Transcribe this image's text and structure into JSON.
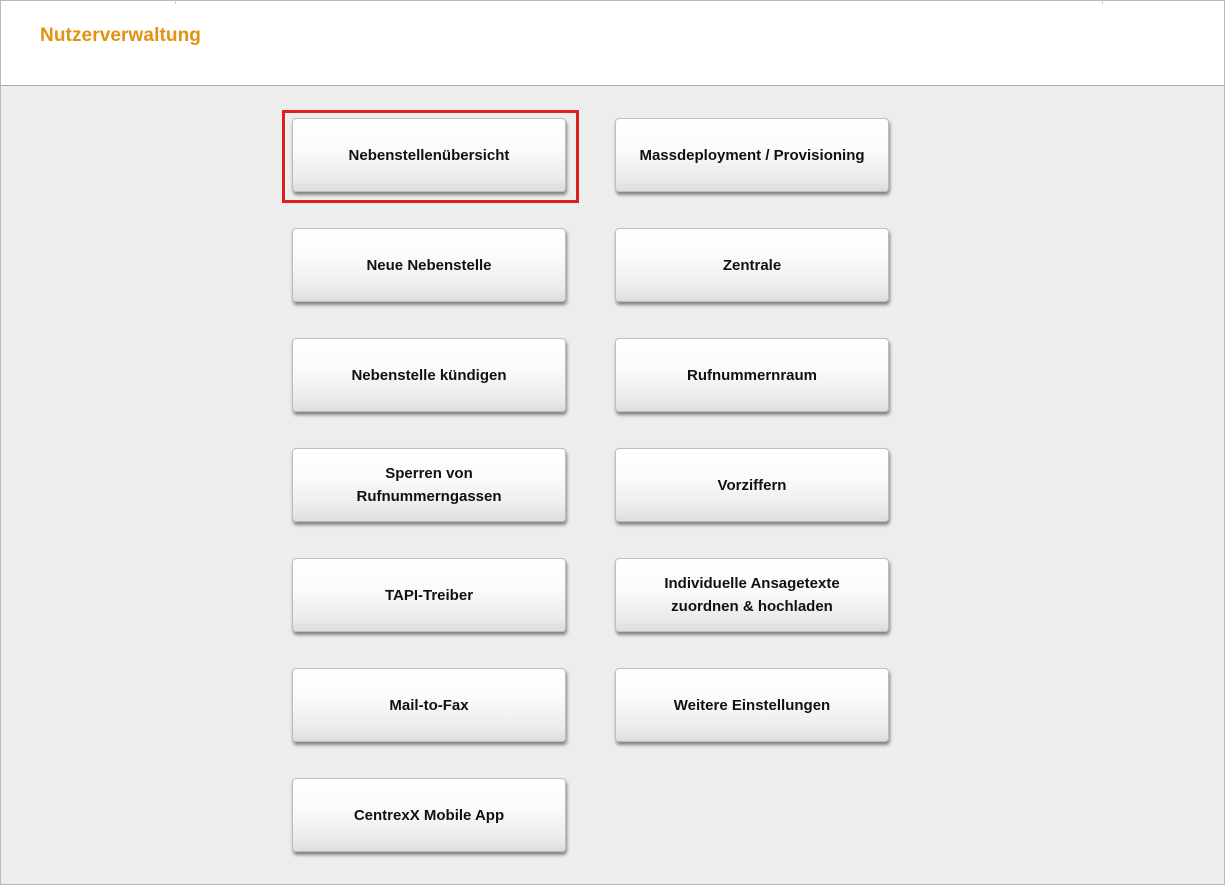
{
  "header": {
    "title": "Nutzerverwaltung"
  },
  "menu": {
    "left": [
      "Nebenstellenübersicht",
      "Neue Nebenstelle",
      "Nebenstelle kündigen",
      "Sperren von Rufnummerngassen",
      "TAPI-Treiber",
      "Mail-to-Fax",
      "CentrexX Mobile App"
    ],
    "right": [
      "Massdeployment / Provisioning",
      "Zentrale",
      "Rufnummernraum",
      "Vorziffern",
      "Individuelle Ansagetexte zuordnen & hochladen",
      "Weitere Einstellungen"
    ]
  },
  "highlighted_item": "Nebenstellenübersicht",
  "colors": {
    "title": "#e3920f",
    "highlight": "#dc2020",
    "background": "#ededed"
  }
}
